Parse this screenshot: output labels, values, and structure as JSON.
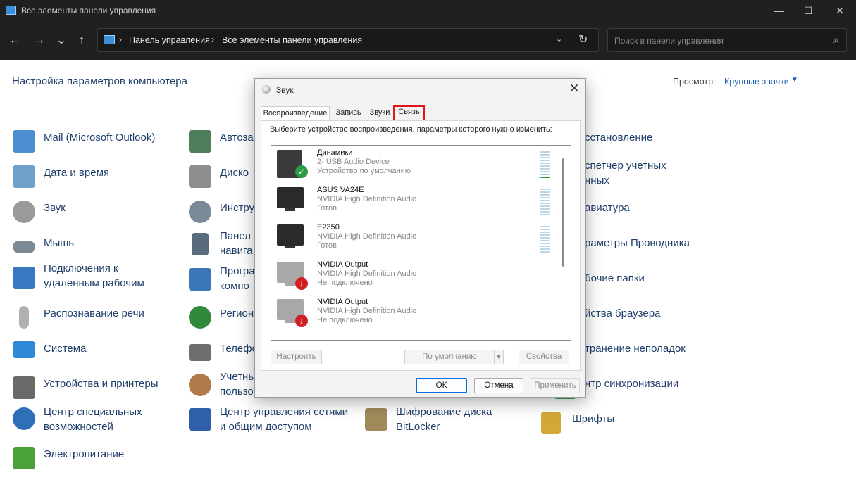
{
  "window": {
    "title": "Все элементы панели управления",
    "minimize": "—",
    "maximize": "☐",
    "close": "✕"
  },
  "nav": {
    "back": "←",
    "forward": "→",
    "history": "⌄",
    "up": "↑"
  },
  "address": {
    "crumb1": "Панель управления",
    "crumb2": "Все элементы панели управления",
    "separator": "›",
    "dropdown": "⌄",
    "refresh": "↻"
  },
  "search": {
    "placeholder": "Поиск в панели управления",
    "icon": "⌕"
  },
  "header": {
    "title": "Настройка параметров компьютера",
    "view_label": "Просмотр:",
    "view_value": "Крупные значки",
    "view_arrow": "▼"
  },
  "items": [
    {
      "label": "Mail (Microsoft Outlook)",
      "icon": "mail-icon",
      "color": "#4b8fd1"
    },
    {
      "label": "Дата и время",
      "icon": "clock-icon",
      "color": "#6fa0c9"
    },
    {
      "label": "Звук",
      "icon": "speaker-icon",
      "color": "#9a9a9a"
    },
    {
      "label": "Мышь",
      "icon": "mouse-icon",
      "color": "#7c8a96"
    },
    {
      "label": "Подключения к удаленным рабочим",
      "line1": "Подключения к",
      "line2": "удаленным рабочим",
      "icon": "remote-desktop-icon",
      "color": "#3a78c2"
    },
    {
      "label": "Распознавание речи",
      "icon": "microphone-icon",
      "color": "#b0b0b0"
    },
    {
      "label": "Система",
      "icon": "computer-icon",
      "color": "#2e89d6"
    },
    {
      "label": "Устройства и принтеры",
      "icon": "printer-icon",
      "color": "#6a6a6a"
    },
    {
      "label": "Центр специальных возможностей",
      "line1": "Центр специальных",
      "line2": "возможностей",
      "icon": "accessibility-icon",
      "color": "#2f6fb7"
    },
    {
      "label": "Электропитание",
      "icon": "power-icon",
      "color": "#4aa13a"
    },
    {
      "label": "Автоза",
      "icon": "autoplay-icon",
      "color": "#4d7d5a"
    },
    {
      "label": "Диско",
      "icon": "storage-icon",
      "color": "#8e8e8e"
    },
    {
      "label": "Инстру",
      "icon": "tools-icon",
      "color": "#7a8a99"
    },
    {
      "label": "Панел навига",
      "line1": "Панел",
      "line2": "навига",
      "icon": "taskbar-icon",
      "color": "#5a6b7c"
    },
    {
      "label": "Програ компо",
      "line1": "Програ",
      "line2": "компо",
      "icon": "programs-icon",
      "color": "#3b76b8"
    },
    {
      "label": "Регион",
      "icon": "globe-icon",
      "color": "#2f8a3e"
    },
    {
      "label": "Телефо",
      "icon": "phone-icon",
      "color": "#6e6e6e"
    },
    {
      "label": "Учетнь пользо",
      "line1": "Учетнь",
      "line2": "пользо",
      "icon": "users-icon",
      "color": "#b07a4a"
    },
    {
      "label": "Центр управления сетями и общим доступом",
      "line1": "Центр управления сетями",
      "line2": "и общим доступом",
      "icon": "network-icon",
      "color": "#2f5fa8"
    },
    {
      "label": "Шифрование диска BitLocker",
      "line1": "Шифрование диска",
      "line2": "BitLocker",
      "icon": "key-icon",
      "color": "#a08a5a"
    },
    {
      "label": "сстановление",
      "icon": "recovery-icon",
      "color": "#4d7da8"
    },
    {
      "label": "спетчер учетных нных",
      "line1": "спетчер учетных",
      "line2": "нных",
      "icon": "credential-icon",
      "color": "#b8a060"
    },
    {
      "label": "авиатура",
      "icon": "keyboard-icon",
      "color": "#7a7a7a"
    },
    {
      "label": "раметры Проводника",
      "icon": "folder-options-icon",
      "color": "#d4a836"
    },
    {
      "label": "бочие папки",
      "icon": "work-folders-icon",
      "color": "#d4a836"
    },
    {
      "label": "йства браузера",
      "icon": "browser-icon",
      "color": "#3a7bc8"
    },
    {
      "label": "транение неполадок",
      "icon": "troubleshoot-icon",
      "color": "#5a86b0"
    },
    {
      "label": "нтр синхронизации",
      "icon": "sync-icon",
      "color": "#3fa04a"
    },
    {
      "label": "Шрифты",
      "icon": "fonts-icon",
      "color": "#d4a836"
    }
  ],
  "dialog": {
    "title": "Звук",
    "close": "✕",
    "tabs": [
      "Воспроизведение",
      "Запись",
      "Звуки",
      "Связь"
    ],
    "instruction": "Выберите устройство воспроизведения, параметры которого нужно изменить:",
    "devices": [
      {
        "name": "Динамики",
        "desc": "2- USB Audio Device",
        "status": "Устройство по умолчанию",
        "icon": "speaker-device-icon",
        "badge": "check",
        "badge_glyph": "✓",
        "badge_color": "#2d9a45"
      },
      {
        "name": "ASUS VA24E",
        "desc": "NVIDIA High Definition Audio",
        "status": "Готов",
        "icon": "monitor-icon",
        "badge": "none"
      },
      {
        "name": "E2350",
        "desc": "NVIDIA High Definition Audio",
        "status": "Готов",
        "icon": "monitor-icon",
        "badge": "none"
      },
      {
        "name": "NVIDIA Output",
        "desc": "NVIDIA High Definition Audio",
        "status": "Не подключено",
        "icon": "monitor-disabled-icon",
        "badge": "down",
        "badge_glyph": "↓",
        "badge_color": "#d11f26"
      },
      {
        "name": "NVIDIA Output",
        "desc": "NVIDIA High Definition Audio",
        "status": "Не подключено",
        "icon": "monitor-disabled-icon",
        "badge": "down",
        "badge_glyph": "↓",
        "badge_color": "#d11f26"
      }
    ],
    "configure": "Настроить",
    "set_default": "По умолчанию",
    "set_default_arrow": "▼",
    "properties": "Свойства",
    "ok": "ОК",
    "cancel": "Отмена",
    "apply": "Применить"
  }
}
